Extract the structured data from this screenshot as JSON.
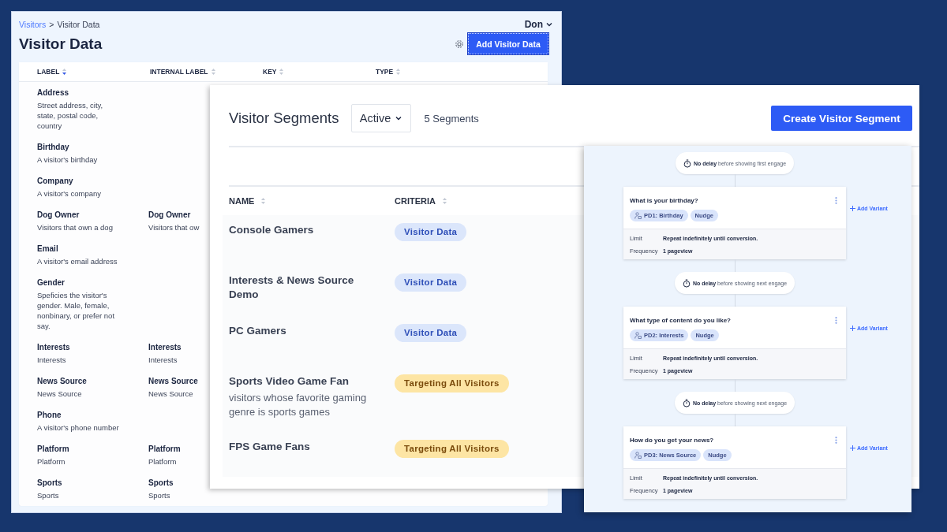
{
  "visitor_data": {
    "breadcrumb": [
      {
        "label": "Visitors",
        "kind": "link"
      },
      {
        "label": ">",
        "kind": "separator"
      },
      {
        "label": "Visitor Data",
        "kind": "current"
      }
    ],
    "user_menu": "Don",
    "title": "Visitor Data",
    "add_button": "Add Visitor Data",
    "table": {
      "columns": [
        {
          "label": "LABEL",
          "sorted": true
        },
        {
          "label": "INTERNAL LABEL",
          "sorted": false
        },
        {
          "label": "KEY",
          "sorted": false
        },
        {
          "label": "TYPE",
          "sorted": false
        }
      ],
      "rows": [
        {
          "label": "Address",
          "description": "Street address, city, state, postal code, country"
        },
        {
          "label": "Birthday",
          "description": "A visitor's birthday"
        },
        {
          "label": "Company",
          "description": "A visitor's company"
        },
        {
          "label": "Dog Owner",
          "description": "Visitors that own a dog",
          "internal_label": "Dog Owner",
          "internal_description": "Visitors that ow"
        },
        {
          "label": "Email",
          "description": "A visitor's email address"
        },
        {
          "label": "Gender",
          "description": "Speficies the visitor's gender. Male, female, nonbinary, or prefer not say."
        },
        {
          "label": "Interests",
          "description": "Interests",
          "internal_label": "Interests",
          "internal_description": "Interests"
        },
        {
          "label": "News Source",
          "description": "News Source",
          "internal_label": "News Source",
          "internal_description": "News Source"
        },
        {
          "label": "Phone",
          "description": "A visitor's phone number"
        },
        {
          "label": "Platform",
          "description": "Platform",
          "internal_label": "Platform",
          "internal_description": "Platform"
        },
        {
          "label": "Sports",
          "description": "Sports",
          "internal_label": "Sports",
          "internal_description": "Sports"
        }
      ]
    }
  },
  "segments": {
    "title": "Visitor Segments",
    "filter": "Active",
    "count": "5 Segments",
    "create_button": "Create Visitor Segment",
    "columns": [
      "NAME",
      "CRITERIA"
    ],
    "rows": [
      {
        "name": "Console Gamers",
        "criteria": "Visitor Data",
        "color": "#dbe6fb"
      },
      {
        "name": "Interests & News Source Demo",
        "criteria": "Visitor Data",
        "color": "#dbe6fb"
      },
      {
        "name": "PC Gamers",
        "criteria": "Visitor Data",
        "color": "#dbe6fb"
      },
      {
        "name": "Sports Video Game Fan",
        "description": "visitors whose favorite gaming genre is sports games",
        "criteria": "Targeting All Visitors",
        "color": "#fde5a4"
      },
      {
        "name": "FPS Game Fans",
        "criteria": "Targeting All Visitors",
        "color": "#fde5a4"
      }
    ]
  },
  "flow": {
    "steps": [
      {
        "delay": "**No delay** before showing first engage",
        "question": "What is your birthday?",
        "tags": [
          {
            "label": "PD1: Birthday",
            "kind": "data"
          },
          {
            "label": "Nudge",
            "kind": "type"
          }
        ],
        "limit_label": "Limit",
        "limit": "Repeat indefinitely until conversion.",
        "frequency_label": "Frequency",
        "frequency": "1 pageview",
        "add_variant": "Add Variant"
      },
      {
        "delay": "**No delay** before showing next engage",
        "question": "What type of content do you like?",
        "tags": [
          {
            "label": "PD2: Interests",
            "kind": "data"
          },
          {
            "label": "Nudge",
            "kind": "type"
          }
        ],
        "limit_label": "Limit",
        "limit": "Repeat indefinitely until conversion.",
        "frequency_label": "Frequency",
        "frequency": "1 pageview",
        "add_variant": "Add Variant"
      },
      {
        "delay": "**No delay** before showing next engage",
        "question": "How do you get your news?",
        "tags": [
          {
            "label": "PD3: News Source",
            "kind": "data"
          },
          {
            "label": "Nudge",
            "kind": "type"
          }
        ],
        "limit_label": "Limit",
        "limit": "Repeat indefinitely until conversion.",
        "frequency_label": "Frequency",
        "frequency": "1 pageview",
        "add_variant": "Add Variant"
      }
    ]
  }
}
